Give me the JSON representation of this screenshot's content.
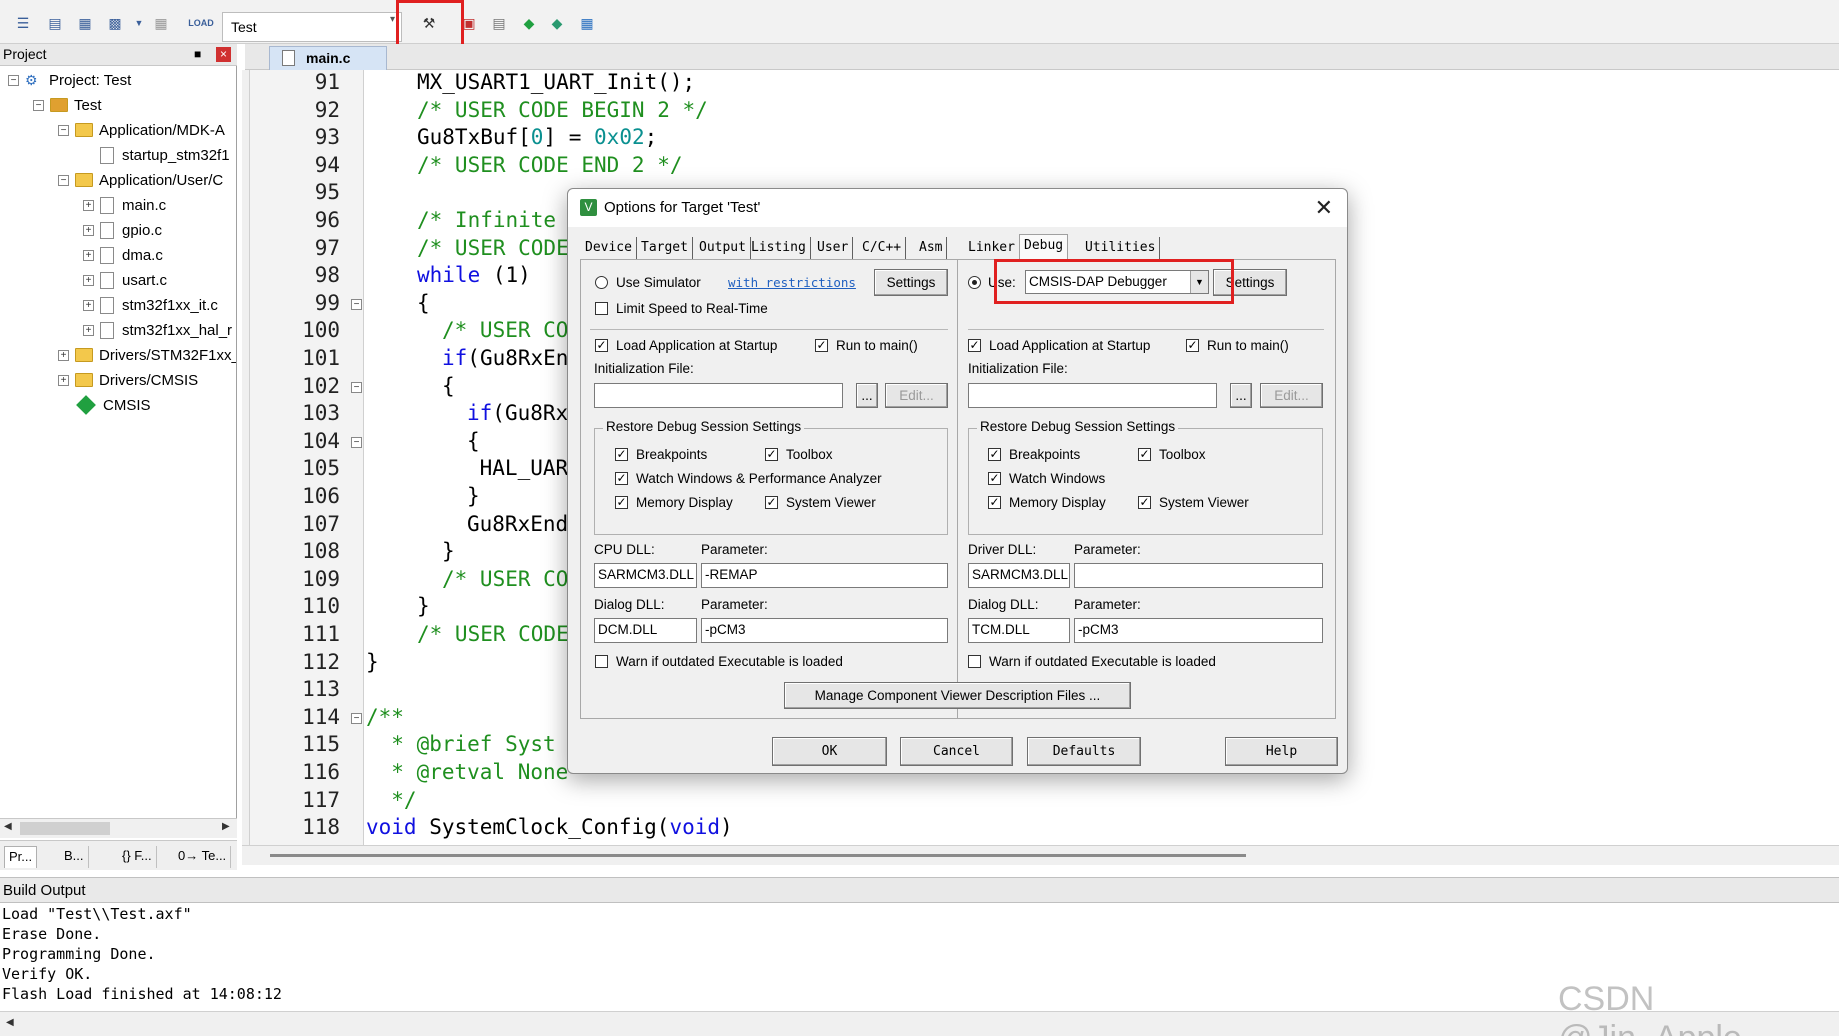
{
  "toolbar": {
    "target_name": "Test",
    "icons": [
      "translate-icon",
      "build-icon",
      "rebuild-icon",
      "batch-build-icon",
      "stop-build-icon",
      "download-icon",
      "target-options-icon",
      "manage-project-icon",
      "pack-installer-icon",
      "select-packs-icon",
      "run-time-env-icon"
    ],
    "load_label": "LOAD"
  },
  "project_panel": {
    "title": "Project",
    "items": [
      {
        "label": "Project: Test",
        "level": 0,
        "type": "project",
        "expander": "-"
      },
      {
        "label": "Test",
        "level": 1,
        "type": "target",
        "expander": "-"
      },
      {
        "label": "Application/MDK-A",
        "level": 2,
        "type": "folder",
        "expander": "-"
      },
      {
        "label": "startup_stm32f1",
        "level": 3,
        "type": "file",
        "expander": ""
      },
      {
        "label": "Application/User/C",
        "level": 2,
        "type": "folder",
        "expander": "-"
      },
      {
        "label": "main.c",
        "level": 3,
        "type": "file",
        "expander": "+"
      },
      {
        "label": "gpio.c",
        "level": 3,
        "type": "file",
        "expander": "+"
      },
      {
        "label": "dma.c",
        "level": 3,
        "type": "file",
        "expander": "+"
      },
      {
        "label": "usart.c",
        "level": 3,
        "type": "file",
        "expander": "+"
      },
      {
        "label": "stm32f1xx_it.c",
        "level": 3,
        "type": "file",
        "expander": "+"
      },
      {
        "label": "stm32f1xx_hal_r",
        "level": 3,
        "type": "file",
        "expander": "+"
      },
      {
        "label": "Drivers/STM32F1xx_",
        "level": 2,
        "type": "folder",
        "expander": "+"
      },
      {
        "label": "Drivers/CMSIS",
        "level": 2,
        "type": "folder",
        "expander": "+"
      },
      {
        "label": "CMSIS",
        "level": 2,
        "type": "component",
        "expander": ""
      }
    ],
    "tabs": [
      "Pr...",
      "B...",
      "{} F...",
      "0→ Te..."
    ]
  },
  "editor": {
    "tab": "main.c",
    "lines": [
      {
        "num": "91",
        "fold": "",
        "parts": [
          [
            "",
            "MX_USART1_UART_Init();"
          ]
        ],
        "indent": 1
      },
      {
        "num": "92",
        "fold": "",
        "parts": [
          [
            "com",
            "/* USER CODE BEGIN 2 */"
          ]
        ],
        "indent": 1
      },
      {
        "num": "93",
        "fold": "",
        "parts": [
          [
            "",
            "Gu8TxBuf["
          ],
          [
            "num",
            "0"
          ],
          [
            "",
            "] = "
          ],
          [
            "num",
            "0x02"
          ],
          [
            "",
            ";"
          ]
        ],
        "indent": 1
      },
      {
        "num": "94",
        "fold": "",
        "parts": [
          [
            "com",
            "/* USER CODE END 2 */"
          ]
        ],
        "indent": 1
      },
      {
        "num": "95",
        "fold": "",
        "parts": [],
        "indent": 1
      },
      {
        "num": "96",
        "fold": "",
        "parts": [
          [
            "com",
            "/* Infinite l"
          ]
        ],
        "indent": 1
      },
      {
        "num": "97",
        "fold": "",
        "parts": [
          [
            "com",
            "/* USER CODE"
          ]
        ],
        "indent": 1
      },
      {
        "num": "98",
        "fold": "",
        "parts": [
          [
            "kw",
            "while"
          ],
          [
            "",
            " (1)"
          ]
        ],
        "indent": 1
      },
      {
        "num": "99",
        "fold": "-",
        "parts": [
          [
            "",
            "{"
          ]
        ],
        "indent": 1
      },
      {
        "num": "100",
        "fold": "",
        "parts": [
          [
            "com",
            "/* USER COD"
          ]
        ],
        "indent": 2
      },
      {
        "num": "101",
        "fold": "",
        "parts": [
          [
            "kw",
            "if"
          ],
          [
            "",
            "(Gu8RxEnd"
          ]
        ],
        "indent": 2
      },
      {
        "num": "102",
        "fold": "-",
        "parts": [
          [
            "",
            "{"
          ]
        ],
        "indent": 2
      },
      {
        "num": "103",
        "fold": "",
        "parts": [
          [
            "kw",
            "if"
          ],
          [
            "",
            "(Gu8RxD"
          ]
        ],
        "indent": 3
      },
      {
        "num": "104",
        "fold": "-",
        "parts": [
          [
            "",
            "{"
          ]
        ],
        "indent": 3
      },
      {
        "num": "105",
        "fold": "",
        "parts": [
          [
            "",
            " HAL_UART"
          ]
        ],
        "indent": 3
      },
      {
        "num": "106",
        "fold": "",
        "parts": [
          [
            "",
            "}"
          ]
        ],
        "indent": 3
      },
      {
        "num": "107",
        "fold": "",
        "parts": [
          [
            "",
            "Gu8RxEndF"
          ]
        ],
        "indent": 3
      },
      {
        "num": "108",
        "fold": "",
        "parts": [
          [
            "",
            "}"
          ]
        ],
        "indent": 2
      },
      {
        "num": "109",
        "fold": "",
        "parts": [
          [
            "com",
            "/* USER COD"
          ]
        ],
        "indent": 2
      },
      {
        "num": "110",
        "fold": "",
        "parts": [
          [
            "",
            "}"
          ]
        ],
        "indent": 1
      },
      {
        "num": "111",
        "fold": "",
        "parts": [
          [
            "com",
            "/* USER CODE"
          ]
        ],
        "indent": 1
      },
      {
        "num": "112",
        "fold": "",
        "parts": [
          [
            "",
            "}"
          ]
        ],
        "indent": 0
      },
      {
        "num": "113",
        "fold": "",
        "parts": [],
        "indent": 0
      },
      {
        "num": "114",
        "fold": "-",
        "parts": [
          [
            "com",
            "/**"
          ]
        ],
        "indent": 0
      },
      {
        "num": "115",
        "fold": "",
        "parts": [
          [
            "com",
            "  * @brief Syst"
          ]
        ],
        "indent": 0
      },
      {
        "num": "116",
        "fold": "",
        "parts": [
          [
            "com",
            "  * @retval None"
          ]
        ],
        "indent": 0
      },
      {
        "num": "117",
        "fold": "",
        "parts": [
          [
            "com",
            "  */"
          ]
        ],
        "indent": 0
      },
      {
        "num": "118",
        "fold": "",
        "parts": [
          [
            "kw",
            "void"
          ],
          [
            "",
            " SystemClock_Config("
          ],
          [
            "kw",
            "void"
          ],
          [
            "",
            ")"
          ]
        ],
        "indent": 0
      }
    ]
  },
  "build_output": {
    "title": "Build Output",
    "lines": [
      "Load \"Test\\\\Test.axf\"",
      "Erase Done.",
      "Programming Done.",
      "Verify OK.",
      "Flash Load finished at 14:08:12"
    ]
  },
  "watermark": "CSDN @Jin_Apple",
  "dialog": {
    "title": "Options for Target 'Test'",
    "tabs": [
      "Device",
      "Target",
      "Output",
      "Listing",
      "User",
      "C/C++",
      "Asm",
      "Linker",
      "Debug",
      "Utilities"
    ],
    "active_tab": "Debug",
    "left": {
      "use_simulator": "Use Simulator",
      "with_restrictions": "with restrictions",
      "settings": "Settings",
      "limit_speed": "Limit Speed to Real-Time",
      "load_app": "Load Application at Startup",
      "run_to_main": "Run to main()",
      "init_file": "Initialization File:",
      "browse": "...",
      "edit": "Edit...",
      "restore_group": "Restore Debug Session Settings",
      "breakpoints": "Breakpoints",
      "toolbox": "Toolbox",
      "watch_windows": "Watch Windows & Performance Analyzer",
      "memory_display": "Memory Display",
      "system_viewer": "System Viewer",
      "cpu_dll_label": "CPU DLL:",
      "cpu_dll": "SARMCM3.DLL",
      "param_label": "Parameter:",
      "cpu_param": "-REMAP",
      "dialog_dll_label": "Dialog DLL:",
      "dialog_dll": "DCM.DLL",
      "dialog_param": "-pCM3",
      "warn": "Warn if outdated Executable is loaded"
    },
    "right": {
      "use": "Use:",
      "debugger": "CMSIS-DAP Debugger",
      "settings": "Settings",
      "load_app": "Load Application at Startup",
      "run_to_main": "Run to main()",
      "init_file": "Initialization File:",
      "browse": "...",
      "edit": "Edit...",
      "restore_group": "Restore Debug Session Settings",
      "breakpoints": "Breakpoints",
      "toolbox": "Toolbox",
      "watch_windows": "Watch Windows",
      "memory_display": "Memory Display",
      "system_viewer": "System Viewer",
      "driver_dll_label": "Driver DLL:",
      "driver_dll": "SARMCM3.DLL",
      "param_label": "Parameter:",
      "driver_param": "",
      "dialog_dll_label": "Dialog DLL:",
      "dialog_dll": "TCM.DLL",
      "dialog_param": "-pCM3",
      "warn": "Warn if outdated Executable is loaded"
    },
    "manage_button": "Manage Component Viewer Description Files ...",
    "ok": "OK",
    "cancel": "Cancel",
    "defaults": "Defaults",
    "help": "Help"
  },
  "colors": {
    "highlight_red": "#e02020",
    "comment_green": "#1f8f1f",
    "keyword_blue": "#1010e0",
    "number_teal": "#0a9090"
  }
}
